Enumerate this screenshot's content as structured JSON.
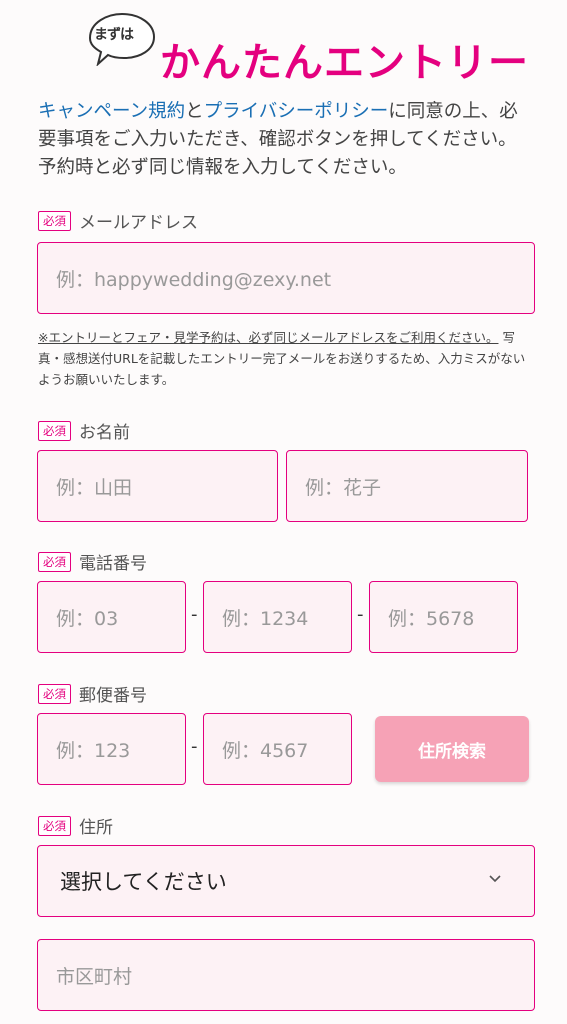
{
  "header": {
    "bubble_text": "まずは",
    "title": "かんたんエントリー"
  },
  "intro": {
    "link1": "キャンペーン規約",
    "and": "と",
    "link2": "プライバシーポリシー",
    "line1_rest": "に同意の上、必",
    "line2": "要事項をご入力いただき、確認ボタンを押してください。",
    "line3": "予約時と必ず同じ情報を入力してください。"
  },
  "required_badge": "必須",
  "email": {
    "label": "メールアドレス",
    "placeholder": "例：happywedding@zexy.net"
  },
  "note": {
    "underlined": "※エントリーとフェア・見学予約は、必ず同じメールアドレスをご利用ください。",
    "rest": " 写真・感想送付URLを記載したエントリー完了メールをお送りするため、入力ミスがないようお願いいたします。"
  },
  "name": {
    "label": "お名前",
    "last_placeholder": "例：山田",
    "first_placeholder": "例：花子"
  },
  "phone": {
    "label": "電話番号",
    "p1": "例：03",
    "p2": "例：1234",
    "p3": "例：5678",
    "dash": "-"
  },
  "postal": {
    "label": "郵便番号",
    "p1": "例：123",
    "p2": "例：4567",
    "dash": "-",
    "search_button": "住所検索"
  },
  "address": {
    "label": "住所",
    "prefecture_select": "選択してください",
    "city_placeholder": "市区町村"
  },
  "colors": {
    "accent": "#e4007f",
    "link": "#1a6fb4",
    "field_bg": "#fdf2f5",
    "button": "#f6a2b6"
  }
}
